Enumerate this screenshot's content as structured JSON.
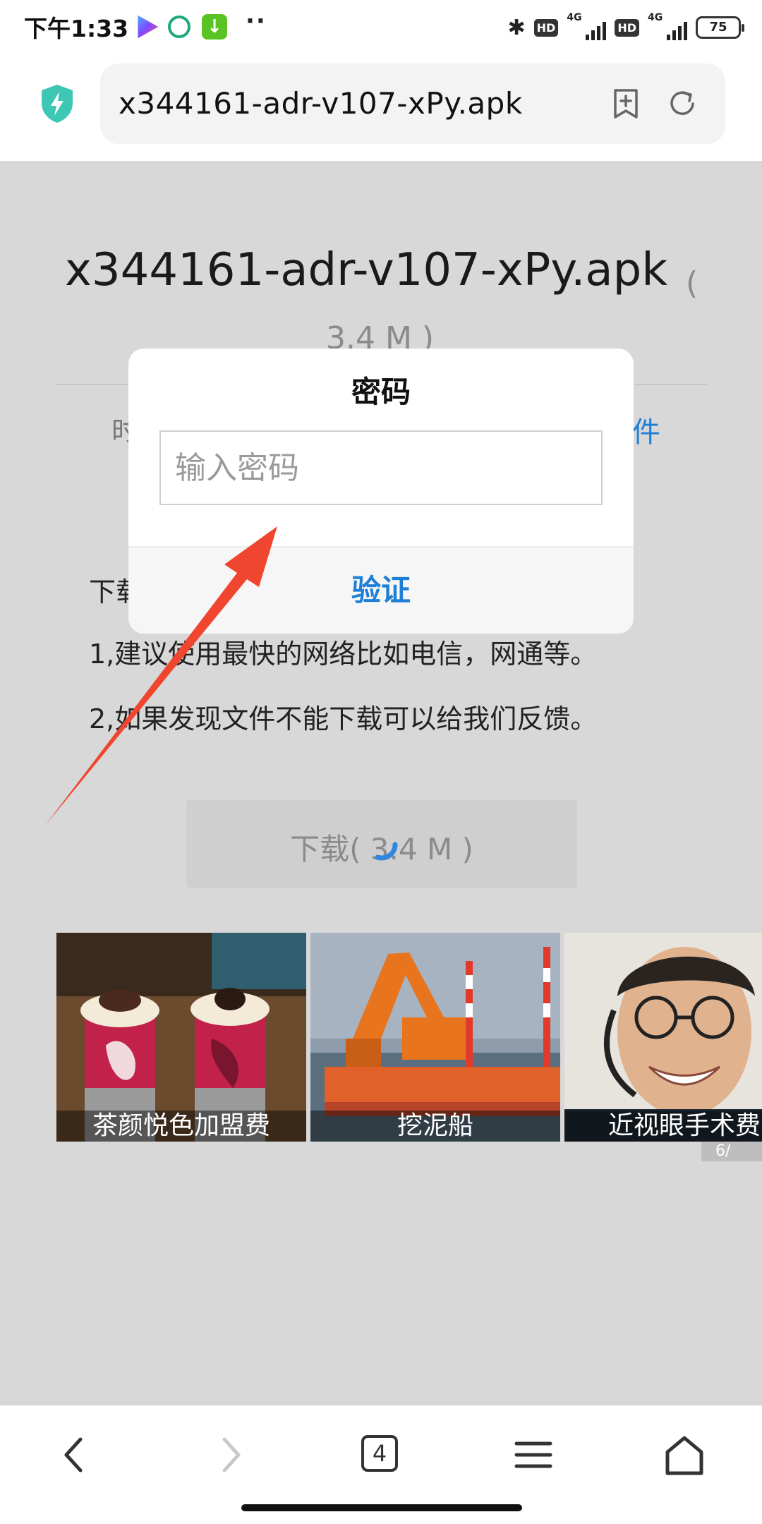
{
  "status_bar": {
    "time": "下午1:33",
    "dots": "··",
    "bluetooth": "✱",
    "hd1": "HD",
    "sig1": "4G",
    "hd2": "HD",
    "sig2": "4G",
    "battery": "75"
  },
  "toolbar": {
    "url": "x344161-adr-v107-xPy.apk",
    "icons": [
      "shield-bolt-icon",
      "bookmark-add-icon",
      "reload-icon"
    ],
    "shield_color": "#3ec7b4"
  },
  "page": {
    "file_title": "x344161-adr-v107-xPy.apk",
    "paren_open": "(",
    "size_text": "3.4 M )",
    "meta_left": "时",
    "meta_right": "件",
    "note_head": "下载",
    "note_1": "1,建议使用最快的网络比如电信，网通等。",
    "note_2": "2,如果发现文件不能下载可以给我们反馈。",
    "download_label": "下载( 3.4 M )"
  },
  "dialog": {
    "title": "密码",
    "input_placeholder": "输入密码",
    "input_value": "",
    "verify_label": "验证",
    "accent": "#1e7fd6"
  },
  "ads": [
    {
      "caption": "茶颜悦色加盟费"
    },
    {
      "caption": "挖泥船"
    },
    {
      "caption": "近视眼手术费"
    }
  ],
  "ad_counter": "6/",
  "bottom_nav": {
    "tab_count": "4",
    "icons": [
      "back-icon",
      "forward-icon",
      "tabs-icon",
      "menu-icon",
      "home-icon"
    ]
  },
  "overlay_arrow_color": "#f0452f"
}
